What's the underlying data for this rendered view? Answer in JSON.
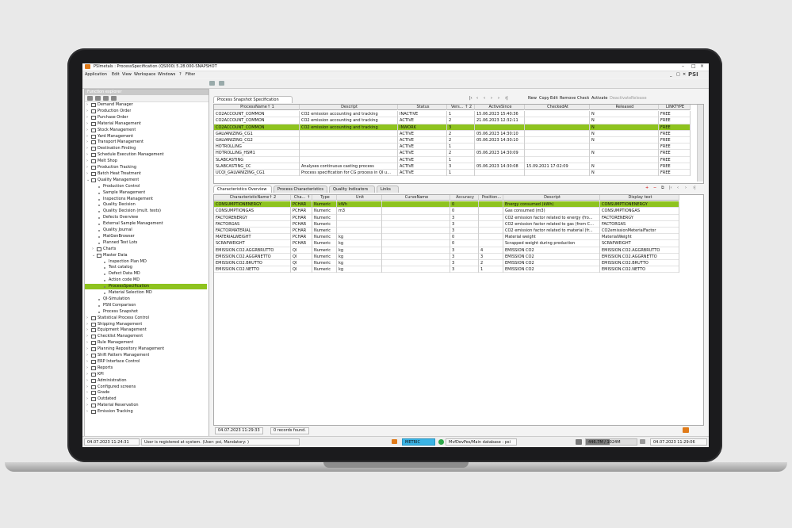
{
  "window": {
    "title": "PSImetals : ProcessSpecification (QS000) 5.28.000-SNAPSHOT",
    "controls": [
      "–",
      "□",
      "×"
    ]
  },
  "menu": [
    {
      "label": "Application"
    },
    {
      "label": "Edit"
    },
    {
      "label": "View"
    },
    {
      "label": "Workspace"
    },
    {
      "label": "Windows"
    },
    {
      "label": "?"
    },
    {
      "label": "Filter"
    }
  ],
  "toolbar_right": [
    "_",
    "□",
    "✕"
  ],
  "brand": "PSI",
  "left_panel": {
    "title": "Function explorer",
    "tree": [
      {
        "label": "Demand Manager",
        "lvl": 0,
        "kind": "folder"
      },
      {
        "label": "Production Order",
        "lvl": 0,
        "kind": "folder"
      },
      {
        "label": "Purchase Order",
        "lvl": 0,
        "kind": "folder"
      },
      {
        "label": "Material Management",
        "lvl": 0,
        "kind": "folder"
      },
      {
        "label": "Stock Management",
        "lvl": 0,
        "kind": "folder"
      },
      {
        "label": "Yard Management",
        "lvl": 0,
        "kind": "folder"
      },
      {
        "label": "Transport Management",
        "lvl": 0,
        "kind": "folder"
      },
      {
        "label": "Destination Finding",
        "lvl": 0,
        "kind": "folder"
      },
      {
        "label": "Schedule Execution Management",
        "lvl": 0,
        "kind": "folder"
      },
      {
        "label": "Melt Shop",
        "lvl": 0,
        "kind": "folder"
      },
      {
        "label": "Production Tracking",
        "lvl": 0,
        "kind": "folder"
      },
      {
        "label": "Batch Heat Treatment",
        "lvl": 0,
        "kind": "folder"
      },
      {
        "label": "Quality Management",
        "lvl": 0,
        "kind": "folder",
        "open": true
      },
      {
        "label": "Production Control",
        "lvl": 1,
        "kind": "leaf"
      },
      {
        "label": "Sample Management",
        "lvl": 1,
        "kind": "leaf"
      },
      {
        "label": "Inspections Management",
        "lvl": 1,
        "kind": "leaf"
      },
      {
        "label": "Quality Decision",
        "lvl": 1,
        "kind": "leaf"
      },
      {
        "label": "Quality Decision (mult. tests)",
        "lvl": 1,
        "kind": "leaf"
      },
      {
        "label": "Defects Overview",
        "lvl": 1,
        "kind": "leaf"
      },
      {
        "label": "External Sample Management",
        "lvl": 1,
        "kind": "leaf"
      },
      {
        "label": "Quality Journal",
        "lvl": 1,
        "kind": "leaf"
      },
      {
        "label": "MatGenBrowser",
        "lvl": 1,
        "kind": "leaf"
      },
      {
        "label": "Planned Test Lots",
        "lvl": 1,
        "kind": "leaf"
      },
      {
        "label": "Charts",
        "lvl": 1,
        "kind": "folder"
      },
      {
        "label": "Master Data",
        "lvl": 1,
        "kind": "folder",
        "open": true
      },
      {
        "label": "Inspection Plan MD",
        "lvl": 2,
        "kind": "leaf"
      },
      {
        "label": "Test catalog",
        "lvl": 2,
        "kind": "leaf"
      },
      {
        "label": "Defect Data MD",
        "lvl": 2,
        "kind": "leaf"
      },
      {
        "label": "Action code MD",
        "lvl": 2,
        "kind": "leaf"
      },
      {
        "label": "ProcessSpecification",
        "lvl": 2,
        "kind": "leaf",
        "selected": true
      },
      {
        "label": "Material Selection MD",
        "lvl": 2,
        "kind": "leaf"
      },
      {
        "label": "QI-Simulation",
        "lvl": 1,
        "kind": "leaf"
      },
      {
        "label": "PSN Comparison",
        "lvl": 1,
        "kind": "leaf"
      },
      {
        "label": "Process Snapshot",
        "lvl": 1,
        "kind": "leaf"
      },
      {
        "label": "Statistical Process Control",
        "lvl": 0,
        "kind": "folder"
      },
      {
        "label": "Shipping Management",
        "lvl": 0,
        "kind": "folder"
      },
      {
        "label": "Equipment Management",
        "lvl": 0,
        "kind": "folder"
      },
      {
        "label": "Checklist Management",
        "lvl": 0,
        "kind": "folder"
      },
      {
        "label": "Rule Management",
        "lvl": 0,
        "kind": "folder"
      },
      {
        "label": "Planning Repository Management",
        "lvl": 0,
        "kind": "folder"
      },
      {
        "label": "Shift Pattern Management",
        "lvl": 0,
        "kind": "folder"
      },
      {
        "label": "ERP Interface Control",
        "lvl": 0,
        "kind": "folder"
      },
      {
        "label": "Reports",
        "lvl": 0,
        "kind": "folder"
      },
      {
        "label": "KPI",
        "lvl": 0,
        "kind": "folder"
      },
      {
        "label": "Administration",
        "lvl": 0,
        "kind": "folder"
      },
      {
        "label": "Configured screens",
        "lvl": 0,
        "kind": "folder"
      },
      {
        "label": "Grade",
        "lvl": 0,
        "kind": "folder"
      },
      {
        "label": "Outdated",
        "lvl": 0,
        "kind": "folder"
      },
      {
        "label": "Material Reservation",
        "lvl": 0,
        "kind": "folder"
      },
      {
        "label": "Emission Tracking",
        "lvl": 0,
        "kind": "folder"
      }
    ]
  },
  "top_section": {
    "tab": "Process Snapshot Specification",
    "actions": [
      "New",
      "Copy",
      "Edit",
      "Remove",
      "Check",
      "Activate",
      "Deactivate",
      "Release"
    ],
    "columns": [
      "ProcessName↑ 1",
      "Descript",
      "Status",
      "Vers... ↑ 2",
      "ActiveSince",
      "CheckedAt",
      "Released",
      "LINKTYPE"
    ],
    "rows": [
      [
        "CO2ACCOUNT_COMMON",
        "CO2 emission accounting and tracking",
        "INACTIVE",
        "1",
        "15.06.2023 15:40:36",
        "",
        "N",
        "FREE"
      ],
      [
        "CO2ACCOUNT_COMMON",
        "CO2 emission accounting and tracking",
        "ACTIVE",
        "2",
        "21.06.2023 12:32:11",
        "",
        "N",
        "FREE"
      ],
      [
        "CO2ACCOUNT_COMMON",
        "CO2 emission accounting and tracking",
        "INWORK",
        "3",
        "",
        "",
        "N",
        "FREE"
      ],
      [
        "GALVANIZING_CG1",
        "",
        "ACTIVE",
        "2",
        "05.06.2023 14:30:10",
        "",
        "N",
        "FREE"
      ],
      [
        "GALVANIZING_CG2",
        "",
        "ACTIVE",
        "2",
        "05.06.2023 14:30:10",
        "",
        "N",
        "FREE"
      ],
      [
        "HOTROLLING",
        "",
        "ACTIVE",
        "1",
        "",
        "",
        "",
        "FREE"
      ],
      [
        "HOTROLLING_HSM1",
        "",
        "ACTIVE",
        "2",
        "05.06.2023 14:30:09",
        "",
        "N",
        "FREE"
      ],
      [
        "SLABCASTING",
        "",
        "ACTIVE",
        "1",
        "",
        "",
        "",
        "FREE"
      ],
      [
        "SLABCASTING_CC",
        "Analyses continuous casting process",
        "ACTIVE",
        "3",
        "05.06.2023 14:30:08",
        "15.09.2021 17:02:09",
        "N",
        "FREE"
      ],
      [
        "UCQI_GALVANIZING_CG1",
        "Process specification for CG process in QI u...",
        "ACTIVE",
        "1",
        "",
        "",
        "N",
        "FREE"
      ]
    ],
    "selected_row": 2
  },
  "bottom_section": {
    "tabs": [
      "Characteristics Overview",
      "Process Characteristics",
      "Quality Indicators",
      "Links"
    ],
    "active_tab": 0,
    "columns": [
      "CharacteristicName↑ 2",
      "Cha... ↑",
      "Type",
      "Unit",
      "CurveName",
      "Accuracy",
      "Position...",
      "Descript",
      "Display text"
    ],
    "rows": [
      [
        "CONSUMPTIONENERGY",
        "PCHAR",
        "Numeric",
        "kWh",
        "",
        "0",
        "",
        "Energy consumed (kWh)",
        "CONSUMPTIONENERGY"
      ],
      [
        "CONSUMPTIONGAS",
        "PCHAR",
        "Numeric",
        "m3",
        "",
        "0",
        "",
        "Gas consumed (m3)",
        "CONSUMPTIONGAS"
      ],
      [
        "FACTORENERGY",
        "PCHAR",
        "Numeric",
        "",
        "",
        "3",
        "",
        "CO2 emission factor related to energy (fro...",
        "FACTORENERGY"
      ],
      [
        "FACTORGAS",
        "PCHAR",
        "Numeric",
        "",
        "",
        "3",
        "",
        "CO2 emission factor related to gas (from C...",
        "FACTORGAS"
      ],
      [
        "FACTORMATERIAL",
        "PCHAR",
        "Numeric",
        "",
        "",
        "3",
        "",
        "CO2 emission factor related to material (fr...",
        "CO2emissionMeterialFactor"
      ],
      [
        "MATERIALWEIGHT",
        "PCHAR",
        "Numeric",
        "kg",
        "",
        "0",
        "",
        "Material weight",
        "MaterialWeight"
      ],
      [
        "SCRAPWEIGHT",
        "PCHAR",
        "Numeric",
        "kg",
        "",
        "0",
        "",
        "Scrapped weight during production",
        "SCRAPWEIGHT"
      ],
      [
        "EMISSION.CO2.AGGRBRUTTO",
        "QI",
        "Numeric",
        "kg",
        "",
        "3",
        "4",
        "EMISSION CO2",
        "EMISSION.CO2.AGGRBRUTTO"
      ],
      [
        "EMISSION.CO2.AGGRNETTO",
        "QI",
        "Numeric",
        "kg",
        "",
        "3",
        "3",
        "EMISSION CO2",
        "EMISSION.CO2.AGGRNETTO"
      ],
      [
        "EMISSION.CO2.BRUTTO",
        "QI",
        "Numeric",
        "kg",
        "",
        "3",
        "2",
        "EMISSION CO2",
        "EMISSION.CO2.BRUTTO"
      ],
      [
        "EMISSION.CO2.NETTO",
        "QI",
        "Numeric",
        "kg",
        "",
        "3",
        "1",
        "EMISSION CO2",
        "EMISSION.CO2.NETTO"
      ]
    ],
    "selected_row": 0,
    "footer_time": "04.07.2023 11:29:33",
    "footer_text": "0 records found."
  },
  "statusbar": {
    "left_time": "04.07.2023 11:24:31",
    "message": "User is registered at system. (User: psi, Mandatory: )",
    "metric": "METRIC",
    "db": "MvfDevPes/Main database : psi",
    "memory": "446.7M / 1024M",
    "right_time": "04.07.2023 11:29:06"
  },
  "colors": {
    "highlight": "#8ec31f",
    "brand_orange": "#e07b1a"
  }
}
